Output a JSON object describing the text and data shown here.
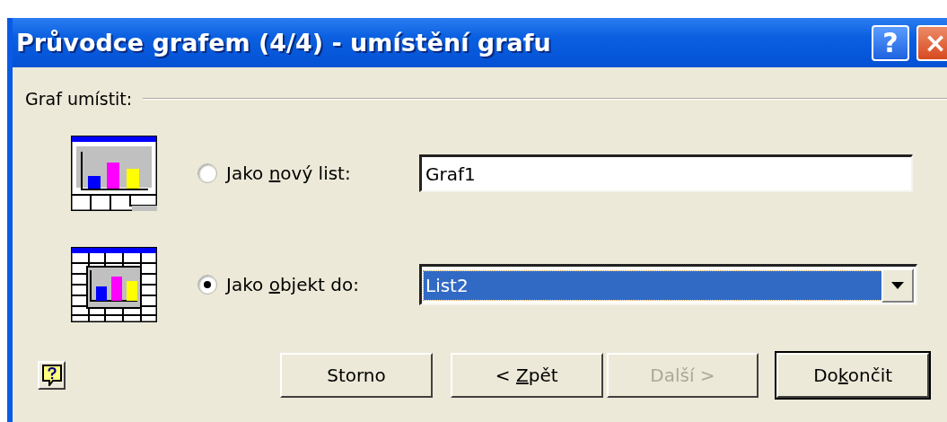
{
  "window": {
    "title": "Průvodce grafem (4/4) - umístění grafu",
    "title_buttons": [
      {
        "kind": "help",
        "label": "?"
      },
      {
        "kind": "close",
        "label": "×"
      }
    ]
  },
  "group": {
    "label": "Graf umístit:"
  },
  "options": [
    {
      "kind": "new_sheet",
      "label_parts": [
        "Jako ",
        "n",
        "ový list:"
      ],
      "selected": false,
      "field": {
        "kind": "text",
        "value": "Graf1"
      }
    },
    {
      "kind": "object",
      "label_parts": [
        "Jako ",
        "o",
        "bjekt do:"
      ],
      "selected": true,
      "field": {
        "kind": "combo",
        "value": "List2"
      }
    }
  ],
  "buttons": [
    {
      "label_parts": [
        "Storno"
      ],
      "disabled": false,
      "default": false
    },
    {
      "label_parts": [
        "< ",
        "Z",
        "pět"
      ],
      "disabled": false,
      "default": false
    },
    {
      "label_parts": [
        "Další >"
      ],
      "disabled": true,
      "default": false
    },
    {
      "label_parts": [
        "Do",
        "k",
        "ončit"
      ],
      "disabled": false,
      "default": true
    }
  ]
}
